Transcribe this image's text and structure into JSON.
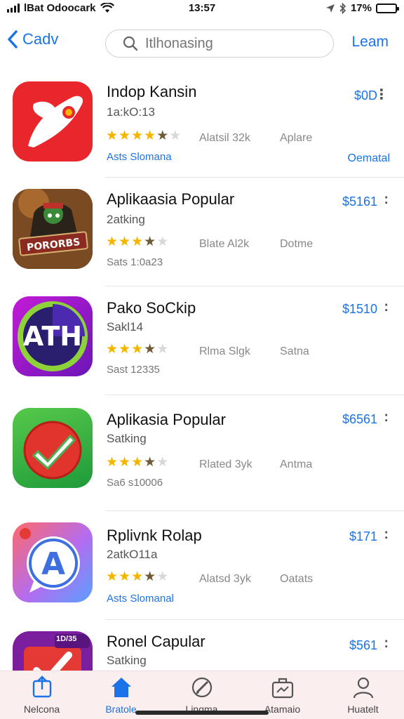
{
  "status_bar": {
    "carrier": "lBat Odoocark",
    "time": "13:57",
    "battery": "17%"
  },
  "nav": {
    "back_label": "Cadv",
    "search_placeholder": "Itlhonasing",
    "right_label": "Leam"
  },
  "apps": [
    {
      "name": "Indop Kansin",
      "subtitle": "1a:kO:13",
      "rating": 4,
      "rating_text": "Alatsil 32k",
      "extra": "Aplare",
      "foot": "Asts Slomana",
      "foot_style": "blue",
      "price": "$0D",
      "right_link": "Oematal",
      "icon": "red-feather-icon"
    },
    {
      "name": "Aplikaasia Popular",
      "subtitle": "2atking",
      "rating": 3,
      "rating_text": "Blate Al2k",
      "extra": "Dotme",
      "foot": "Sats 1:0a23",
      "foot_style": "gray",
      "price": "$5161",
      "right_link": "",
      "icon": "game-character-icon"
    },
    {
      "name": "Pako SoCkip",
      "subtitle": "Sakl14",
      "rating": 3,
      "rating_text": "Rlma Slgk",
      "extra": "Satna",
      "foot": "Sast 12335",
      "foot_style": "gray",
      "price": "$1510",
      "right_link": "",
      "icon": "ath-logo-icon"
    },
    {
      "name": "Aplikasia Popular",
      "subtitle": "Satking",
      "rating": 3,
      "rating_text": "Rlated 3yk",
      "extra": "Antma",
      "foot": "Sa6 s10006",
      "foot_style": "gray",
      "price": "$6561",
      "right_link": "",
      "icon": "green-check-icon"
    },
    {
      "name": "Rplivnk Rolap",
      "subtitle": "2atkO11a",
      "rating": 3,
      "rating_text": "Alatsd 3yk",
      "extra": "Oatats",
      "foot": "Asts Slomanal",
      "foot_style": "blue",
      "price": "$171",
      "right_link": "",
      "icon": "letter-a-chat-icon"
    },
    {
      "name": "Ronel Capular",
      "subtitle": "Satking",
      "rating": 0,
      "rating_text": "",
      "extra": "",
      "foot": "",
      "foot_style": "gray",
      "price": "$561",
      "right_link": "",
      "icon": "purple-check-icon",
      "badge": "1D/35"
    }
  ],
  "tabs": [
    {
      "label": "Nelcona",
      "icon": "download-box-icon"
    },
    {
      "label": "Bratole",
      "icon": "home-icon"
    },
    {
      "label": "Lingma",
      "icon": "pen-circle-icon"
    },
    {
      "label": "Atamaio",
      "icon": "briefcase-icon"
    },
    {
      "label": "Huatelt",
      "icon": "person-icon"
    }
  ],
  "colors": {
    "accent": "#1a73e8",
    "star": "#f5b400",
    "tab_bar_bg": "#fbeeee"
  }
}
